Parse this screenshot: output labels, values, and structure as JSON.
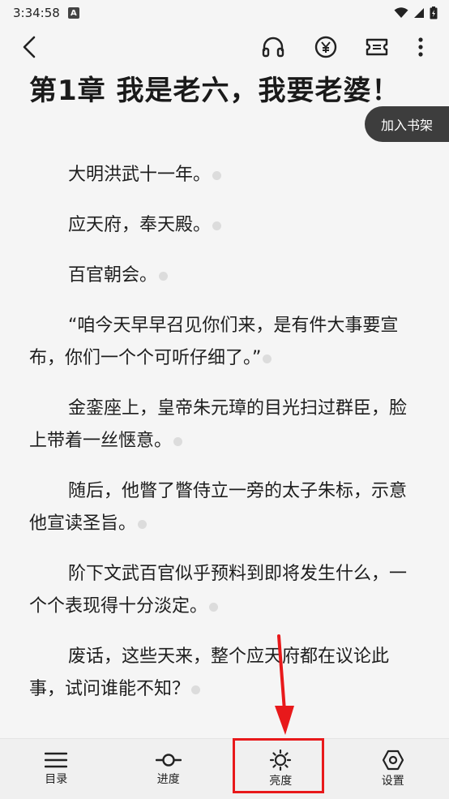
{
  "status_bar": {
    "time": "3:34:58",
    "badge": "A"
  },
  "top_bar": {
    "back_icon": "chevron-left-icon",
    "icons": [
      "headphones-icon",
      "yuan-coin-icon",
      "ticket-icon",
      "more-vertical-icon"
    ]
  },
  "chapter": {
    "title": "第1章 我是老六，我要老婆！"
  },
  "shelf_button": {
    "label": "加入书架"
  },
  "paragraphs": [
    "大明洪武十一年。",
    "应天府，奉天殿。",
    "百官朝会。",
    "“咱今天早早召见你们来，是有件大事要宣布，你们一个个可听仔细了。”",
    "金銮座上，皇帝朱元璋的目光扫过群臣，脸上带着一丝惬意。",
    "随后，他瞥了瞥侍立一旁的太子朱标，示意他宣读圣旨。",
    "阶下文武百官似乎预料到即将发生什么，一个个表现得十分淡定。",
    "废话，这些天来，整个应天府都在议论此事，试问谁能不知？"
  ],
  "bottom_nav": {
    "catalog": "目录",
    "progress": "进度",
    "brightness": "亮度",
    "settings": "设置"
  },
  "colors": {
    "background": "#f5f5f5",
    "shelf_button_bg": "#3d3d3d",
    "highlight": "#e8191b"
  }
}
